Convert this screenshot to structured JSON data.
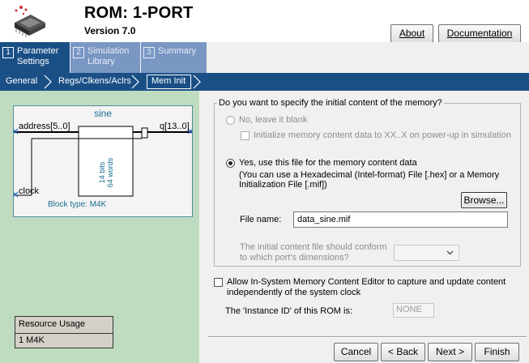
{
  "header": {
    "title": "ROM: 1-PORT",
    "version": "Version 7.0",
    "about_label": "About",
    "documentation_label": "Documentation"
  },
  "tabs": [
    {
      "num": "1",
      "label_line1": "Parameter",
      "label_line2": "Settings"
    },
    {
      "num": "2",
      "label_line1": "Simulation",
      "label_line2": "Library"
    },
    {
      "num": "3",
      "label_line1": "Summary",
      "label_line2": ""
    }
  ],
  "breadcrumb": [
    "General",
    "Regs/Clkens/Aclrs",
    "Mem Init"
  ],
  "diagram": {
    "name": "sine",
    "address_port": "address[5..0]",
    "q_port": "q[13..0]",
    "clock_port": "clock",
    "bits_label": "14 bits",
    "words_label": "64 words",
    "block_type": "Block type: M4K"
  },
  "resource": {
    "title": "Resource Usage",
    "value": "1 M4K"
  },
  "mem_init": {
    "question": "Do you want to specify the initial content of the memory?",
    "option_no": "No, leave it blank",
    "init_xx_label": "Initialize memory content data to XX..X on power-up in simulation",
    "option_yes": "Yes, use this file for the memory content data",
    "hint_line1": "(You can use a Hexadecimal (Intel-format) File [.hex] or a Memory",
    "hint_line2": "Initialization File [.mif])",
    "browse_label": "Browse...",
    "filename_label": "File name:",
    "filename_value": "data_sine.mif",
    "conform_line1": "The initial content file should conform",
    "conform_line2": "to which port's dimensions?",
    "conform_value": ""
  },
  "isme": {
    "checkbox_line1": "Allow In-System Memory Content Editor to capture and update content",
    "checkbox_line2": "independently of the system clock",
    "instance_label": "The 'Instance ID' of this ROM is:",
    "instance_value": "NONE"
  },
  "footer": {
    "cancel": "Cancel",
    "back": "< Back",
    "next": "Next >",
    "finish": "Finish"
  },
  "colors": {
    "tab_active": "#1a4f86",
    "tab_inactive": "#7a97c4",
    "left_panel": "#c0dcc0",
    "diagram_border": "#4f8f9f"
  }
}
